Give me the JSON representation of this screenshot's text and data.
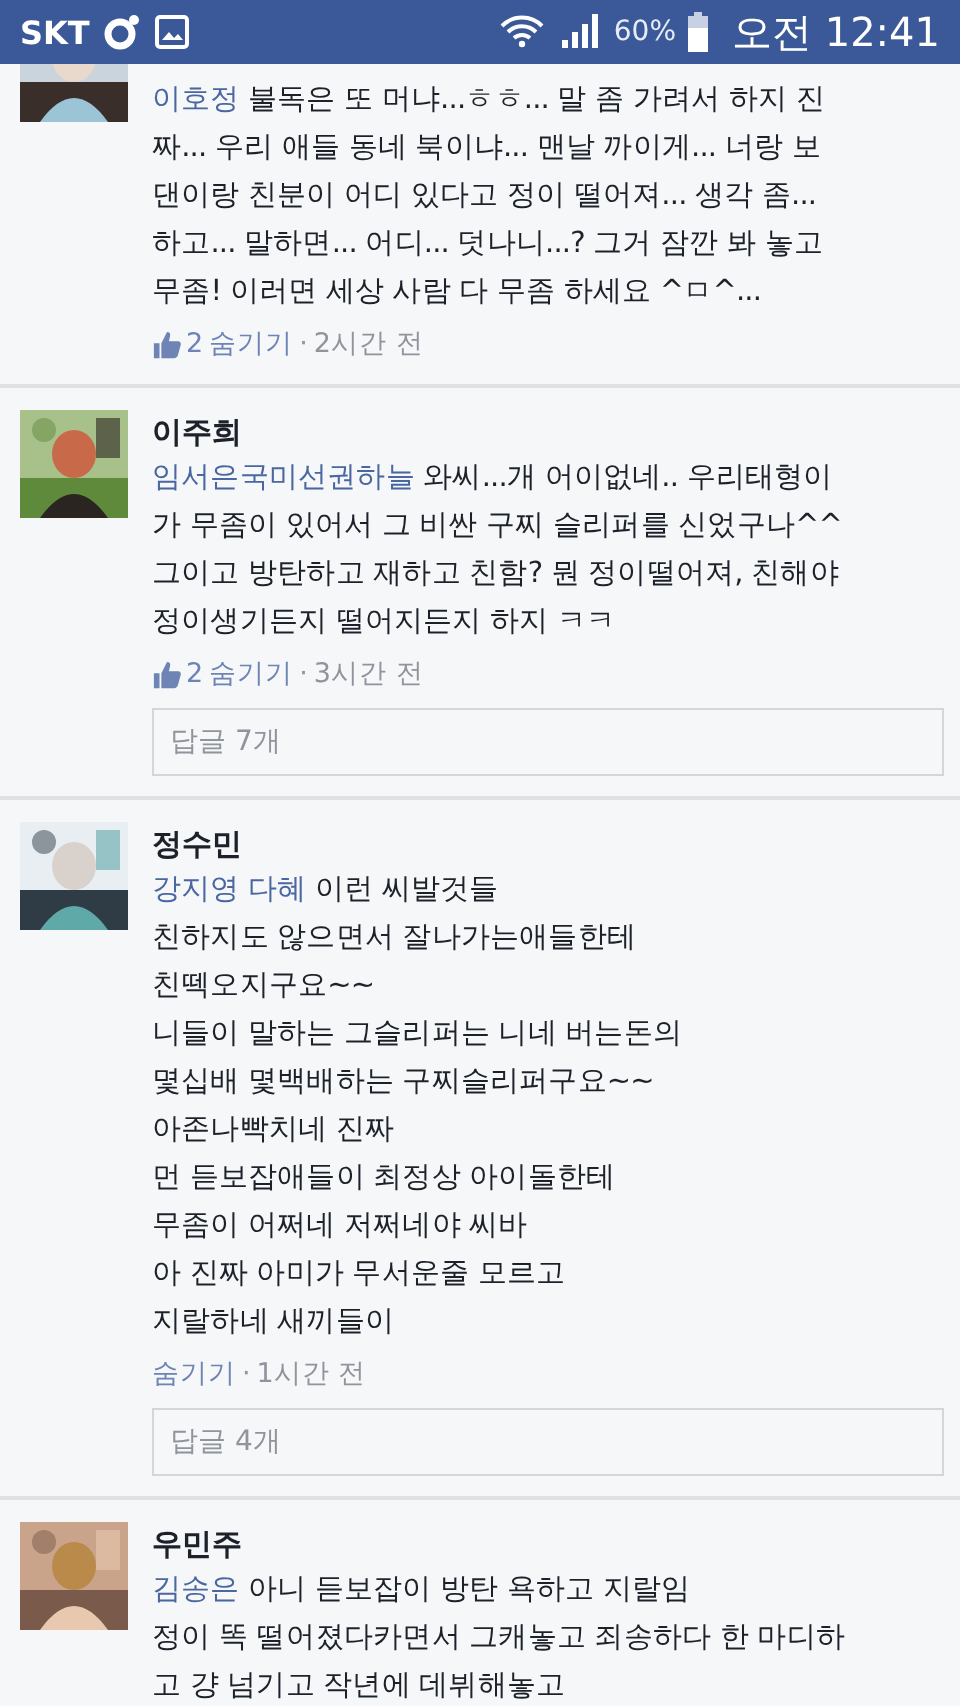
{
  "status_bar": {
    "carrier": "SKT",
    "battery": "60%",
    "time": "오전 12:41"
  },
  "comments": [
    {
      "mention": "이호정",
      "text": "불독은 또 머냐...ㅎㅎ... 말 좀 가려서 하지 진\n짜... 우리 애들 동네 북이냐... 맨날 까이게... 너랑 보\n댄이랑 친분이 어디 있다고 정이 떨어져... 생각 좀...\n하고... 말하면... 어디... 덧나니...? 그거 잠깐 봐 놓고\n무좀! 이러면 세상 사람 다 무좀 하세요 ^ㅁ^...",
      "likes": "2",
      "action": "숨기기",
      "separator": "·",
      "time": "2시간 전"
    },
    {
      "author": "이주희",
      "mention": "임서은국미선권하늘",
      "text": "와씨...개 어이없네.. 우리태형이\n가 무좀이 있어서 그 비싼 구찌 슬리퍼를 신었구나^^\n그이고 방탄하고 재하고 친함? 뭔 정이떨어져, 친해야\n정이생기든지 떨어지든지 하지 ㅋㅋ",
      "likes": "2",
      "action": "숨기기",
      "separator": "·",
      "time": "3시간 전",
      "replies": "답글 7개"
    },
    {
      "author": "정수민",
      "mention": "강지영 다혜",
      "text": "이런 씨발것들\n친하지도 않으면서 잘나가는애들한테\n친떽오지구요~~\n니들이 말하는 그슬리퍼는 니네 버는돈의\n몇십배 몇백배하는 구찌슬리퍼구요~~\n아존나빡치네 진짜\n먼 듣보잡애들이 최정상 아이돌한테\n무좀이 어쩌네 저쩌네야 씨바\n아 진짜 아미가 무서운줄 모르고\n지랄하네 새끼들이",
      "action": "숨기기",
      "separator": "·",
      "time": "1시간 전",
      "replies": "답글 4개"
    },
    {
      "author": "우민주",
      "mention": "김송은",
      "text": "아니 듣보잡이 방탄 욕하고 지랄임\n정이 똑 떨어졌다카면서 그캐놓고 죄송하다 한 마디하\n고 걍 넘기고 작년에 데뷔해놓고"
    }
  ]
}
